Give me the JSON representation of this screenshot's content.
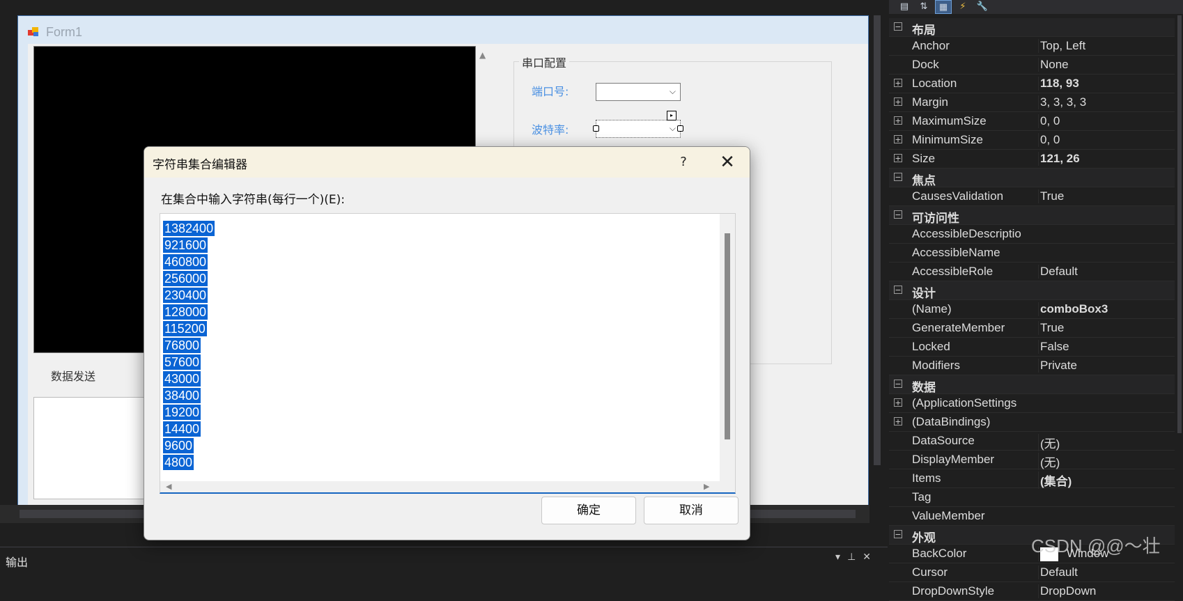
{
  "designer": {
    "form_title": "Form1",
    "serial_group": {
      "title": "串口配置",
      "port_label": "端口号:",
      "baud_label": "波特率:"
    },
    "send_group_title": "数据发送"
  },
  "dialog": {
    "title": "字符串集合编辑器",
    "help": "?",
    "close": "✕",
    "prompt": "在集合中输入字符串(每行一个)(E):",
    "items": [
      "1382400",
      "921600",
      "460800",
      "256000",
      "230400",
      "128000",
      "115200",
      "76800",
      "57600",
      "43000",
      "38400",
      "19200",
      "14400",
      "9600",
      "4800"
    ],
    "ok_label": "确定",
    "cancel_label": "取消"
  },
  "output_panel": {
    "title": "输出"
  },
  "properties": {
    "rows": [
      {
        "kind": "category",
        "name": "布局",
        "exp": "−"
      },
      {
        "kind": "prop",
        "name": "Anchor",
        "value": "Top, Left",
        "bold": false,
        "exp": ""
      },
      {
        "kind": "prop",
        "name": "Dock",
        "value": "None",
        "bold": false,
        "exp": ""
      },
      {
        "kind": "prop",
        "name": "Location",
        "value": "118, 93",
        "bold": true,
        "exp": "+"
      },
      {
        "kind": "prop",
        "name": "Margin",
        "value": "3, 3, 3, 3",
        "bold": false,
        "exp": "+"
      },
      {
        "kind": "prop",
        "name": "MaximumSize",
        "value": "0, 0",
        "bold": false,
        "exp": "+"
      },
      {
        "kind": "prop",
        "name": "MinimumSize",
        "value": "0, 0",
        "bold": false,
        "exp": "+"
      },
      {
        "kind": "prop",
        "name": "Size",
        "value": "121, 26",
        "bold": true,
        "exp": "+"
      },
      {
        "kind": "category",
        "name": "焦点",
        "exp": "−"
      },
      {
        "kind": "prop",
        "name": "CausesValidation",
        "value": "True",
        "bold": false,
        "exp": ""
      },
      {
        "kind": "category",
        "name": "可访问性",
        "exp": "−"
      },
      {
        "kind": "prop",
        "name": "AccessibleDescriptio",
        "value": "",
        "bold": false,
        "exp": ""
      },
      {
        "kind": "prop",
        "name": "AccessibleName",
        "value": "",
        "bold": false,
        "exp": ""
      },
      {
        "kind": "prop",
        "name": "AccessibleRole",
        "value": "Default",
        "bold": false,
        "exp": ""
      },
      {
        "kind": "category",
        "name": "设计",
        "exp": "−"
      },
      {
        "kind": "prop",
        "name": "(Name)",
        "value": "comboBox3",
        "bold": true,
        "exp": ""
      },
      {
        "kind": "prop",
        "name": "GenerateMember",
        "value": "True",
        "bold": false,
        "exp": ""
      },
      {
        "kind": "prop",
        "name": "Locked",
        "value": "False",
        "bold": false,
        "exp": ""
      },
      {
        "kind": "prop",
        "name": "Modifiers",
        "value": "Private",
        "bold": false,
        "exp": ""
      },
      {
        "kind": "category",
        "name": "数据",
        "exp": "−"
      },
      {
        "kind": "prop",
        "name": "(ApplicationSettings",
        "value": "",
        "bold": false,
        "exp": "+"
      },
      {
        "kind": "prop",
        "name": "(DataBindings)",
        "value": "",
        "bold": false,
        "exp": "+"
      },
      {
        "kind": "prop",
        "name": "DataSource",
        "value": "(无)",
        "bold": false,
        "exp": ""
      },
      {
        "kind": "prop",
        "name": "DisplayMember",
        "value": "(无)",
        "bold": false,
        "exp": ""
      },
      {
        "kind": "prop",
        "name": "Items",
        "value": "(集合)",
        "bold": true,
        "exp": ""
      },
      {
        "kind": "prop",
        "name": "Tag",
        "value": "",
        "bold": false,
        "exp": ""
      },
      {
        "kind": "prop",
        "name": "ValueMember",
        "value": "",
        "bold": false,
        "exp": ""
      },
      {
        "kind": "category",
        "name": "外观",
        "exp": "−"
      },
      {
        "kind": "prop",
        "name": "BackColor",
        "value": "Window",
        "bold": false,
        "exp": "",
        "swatch": true
      },
      {
        "kind": "prop",
        "name": "Cursor",
        "value": "Default",
        "bold": false,
        "exp": ""
      },
      {
        "kind": "prop",
        "name": "DropDownStyle",
        "value": "DropDown",
        "bold": false,
        "exp": ""
      }
    ]
  },
  "watermark": "CSDN @@～壮",
  "colors": {
    "selection": "#0a64d4",
    "label_blue": "#4a90e2",
    "ide_dark": "#1f1f1f"
  }
}
